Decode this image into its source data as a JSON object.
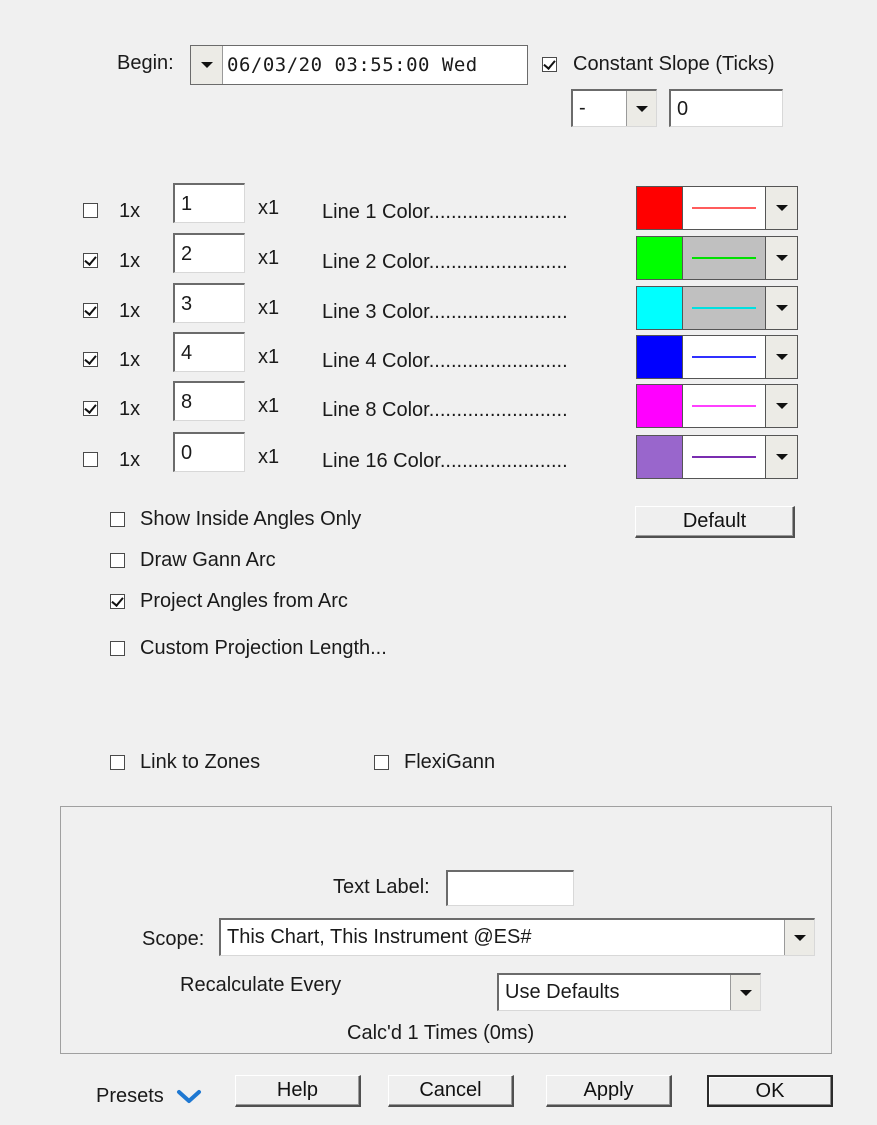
{
  "begin": {
    "label": "Begin:",
    "datetime": "06/03/20 03:55:00 Wed"
  },
  "constant_slope": {
    "label": "Constant Slope (Ticks)",
    "checked": true,
    "sign": "-",
    "value": "0"
  },
  "lines": [
    {
      "checked": false,
      "mult": "1x",
      "value": "1",
      "suffix": "x1",
      "color_label": "Line 1 Color.........................",
      "color": "#ff0000",
      "sample_bg": "#ffffff",
      "sample_color": "#ff5c5c"
    },
    {
      "checked": true,
      "mult": "1x",
      "value": "2",
      "suffix": "x1",
      "color_label": "Line 2 Color.........................",
      "color": "#00ff00",
      "sample_bg": "#c0c0c0",
      "sample_color": "#00e000"
    },
    {
      "checked": true,
      "mult": "1x",
      "value": "3",
      "suffix": "x1",
      "color_label": "Line 3 Color.........................",
      "color": "#00ffff",
      "sample_bg": "#c0c0c0",
      "sample_color": "#00e0e0"
    },
    {
      "checked": true,
      "mult": "1x",
      "value": "4",
      "suffix": "x1",
      "color_label": "Line 4 Color.........................",
      "color": "#0000ff",
      "sample_bg": "#ffffff",
      "sample_color": "#3030ff"
    },
    {
      "checked": true,
      "mult": "1x",
      "value": "8",
      "suffix": "x1",
      "color_label": "Line 8 Color.........................",
      "color": "#ff00ff",
      "sample_bg": "#ffffff",
      "sample_color": "#ff40ff"
    },
    {
      "checked": false,
      "mult": "1x",
      "value": "0",
      "suffix": "x1",
      "color_label": "Line 16 Color.......................",
      "color": "#9966cc",
      "sample_bg": "#ffffff",
      "sample_color": "#7a2db0"
    }
  ],
  "default_button": "Default",
  "options": [
    {
      "label": "Show Inside Angles Only",
      "checked": false
    },
    {
      "label": "Draw Gann Arc",
      "checked": false
    },
    {
      "label": "Project Angles from Arc",
      "checked": true
    },
    {
      "label": "Custom Projection Length...",
      "checked": false
    }
  ],
  "link_to_zones": {
    "label": "Link to Zones",
    "checked": false
  },
  "flexigann": {
    "label": "FlexiGann",
    "checked": false
  },
  "text_label": {
    "label": "Text Label:",
    "value": ""
  },
  "scope": {
    "label": "Scope:",
    "value": "This Chart, This Instrument @ES#"
  },
  "recalculate": {
    "label": "Recalculate Every",
    "value": "Use Defaults"
  },
  "calc_status": "Calc'd 1 Times (0ms)",
  "footer": {
    "presets": "Presets",
    "help": "Help",
    "cancel": "Cancel",
    "apply": "Apply",
    "ok": "OK"
  },
  "colors": {
    "presets_chevron": "#1e78d2"
  }
}
